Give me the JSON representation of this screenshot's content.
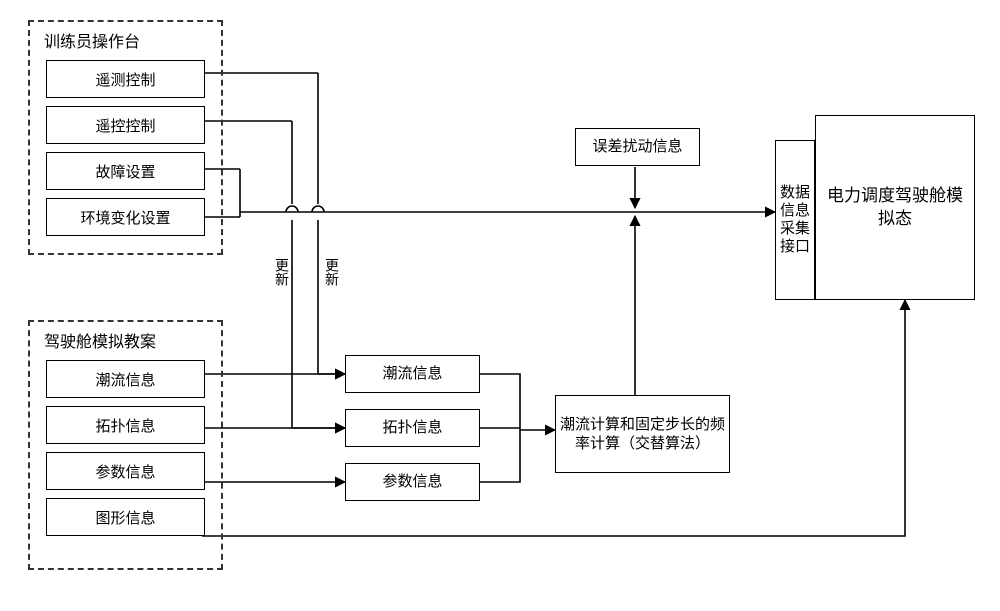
{
  "groups": {
    "trainer_console": {
      "title": "训练员操作台",
      "items": [
        "遥测控制",
        "遥控控制",
        "故障设置",
        "环境变化设置"
      ]
    },
    "cockpit_plan": {
      "title": "驾驶舱模拟教案",
      "items": [
        "潮流信息",
        "拓扑信息",
        "参数信息",
        "图形信息"
      ]
    }
  },
  "mid_info": {
    "flow": "潮流信息",
    "topology": "拓扑信息",
    "param": "参数信息"
  },
  "calc_box": "潮流计算和固定步长的频率计算（交替算法）",
  "error_box": "误差扰动信息",
  "data_if_box": "数据信息采集接口",
  "sim_box": "电力调度驾驶舱模拟态",
  "labels": {
    "update1": "更新",
    "update2": "更新"
  },
  "chart_data": {
    "type": "flowchart",
    "nodes": [
      {
        "id": "trainer_console",
        "type": "group",
        "label": "训练员操作台",
        "children": [
          "遥测控制",
          "遥控控制",
          "故障设置",
          "环境变化设置"
        ]
      },
      {
        "id": "cockpit_plan",
        "type": "group",
        "label": "驾驶舱模拟教案",
        "children": [
          "潮流信息",
          "拓扑信息",
          "参数信息",
          "图形信息"
        ]
      },
      {
        "id": "mid_flow",
        "label": "潮流信息"
      },
      {
        "id": "mid_topology",
        "label": "拓扑信息"
      },
      {
        "id": "mid_param",
        "label": "参数信息"
      },
      {
        "id": "calc",
        "label": "潮流计算和固定步长的频率计算（交替算法）"
      },
      {
        "id": "error",
        "label": "误差扰动信息"
      },
      {
        "id": "data_if",
        "label": "数据信息采集接口"
      },
      {
        "id": "sim",
        "label": "电力调度驾驶舱模拟态"
      }
    ],
    "edges": [
      {
        "from": "trainer_console.遥测控制",
        "to": "mid_flow",
        "label": "更新"
      },
      {
        "from": "trainer_console.遥控控制",
        "to": "mid_topology",
        "label": "更新"
      },
      {
        "from": "trainer_console.故障设置",
        "to": "data_if"
      },
      {
        "from": "trainer_console.环境变化设置",
        "to": "data_if"
      },
      {
        "from": "cockpit_plan.潮流信息",
        "to": "mid_flow"
      },
      {
        "from": "cockpit_plan.拓扑信息",
        "to": "mid_topology"
      },
      {
        "from": "cockpit_plan.参数信息",
        "to": "mid_param"
      },
      {
        "from": "cockpit_plan.图形信息",
        "to": "sim"
      },
      {
        "from": "mid_flow",
        "to": "calc"
      },
      {
        "from": "mid_topology",
        "to": "calc"
      },
      {
        "from": "mid_param",
        "to": "calc"
      },
      {
        "from": "calc",
        "to": "data_if"
      },
      {
        "from": "error",
        "to": "data_if"
      },
      {
        "from": "data_if",
        "to": "sim",
        "relation": "adjacent"
      }
    ]
  }
}
